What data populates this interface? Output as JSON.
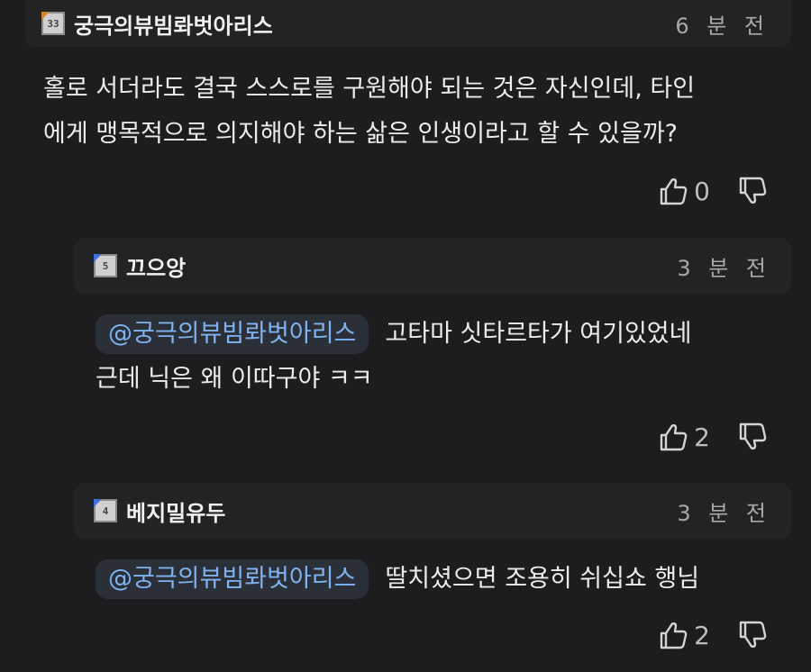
{
  "comments": [
    {
      "author": "궁극의뷰빔롸벗아리스",
      "level": "33",
      "time": "6 분 전",
      "text_line1": "홀로 서더라도 결국 스스로를 구원해야 되는 것은 자신인데, 타인",
      "text_line2": "에게 맹목적으로 의지해야 하는 삶은 인생이라고 할 수 있을까?",
      "likes": "0",
      "badge_color": "#d9822b"
    },
    {
      "author": "끄으앙",
      "level": "5",
      "time": "3 분 전",
      "mention": "@궁극의뷰빔롸벗아리스",
      "text_line1": "고타마 싯타르타가 여기있었네",
      "text_line2": "근데 닉은 왜 이따구야 ㅋㅋ",
      "likes": "2",
      "badge_color": "#3f6fd8"
    },
    {
      "author": "베지밀유두",
      "level": "4",
      "time": "3 분 전",
      "mention": "@궁극의뷰빔롸벗아리스",
      "text_line1": "딸치셨으면 조용히 쉬십쇼 행님",
      "likes": "2",
      "badge_color": "#3f6fd8"
    }
  ],
  "icons": {
    "like": "thumbs-up-icon",
    "dislike": "thumbs-down-icon"
  },
  "colors": {
    "background": "#1d1d1f",
    "header": "#232325",
    "mention_text": "#7fb2f0",
    "mention_bg": "#2b3038"
  }
}
